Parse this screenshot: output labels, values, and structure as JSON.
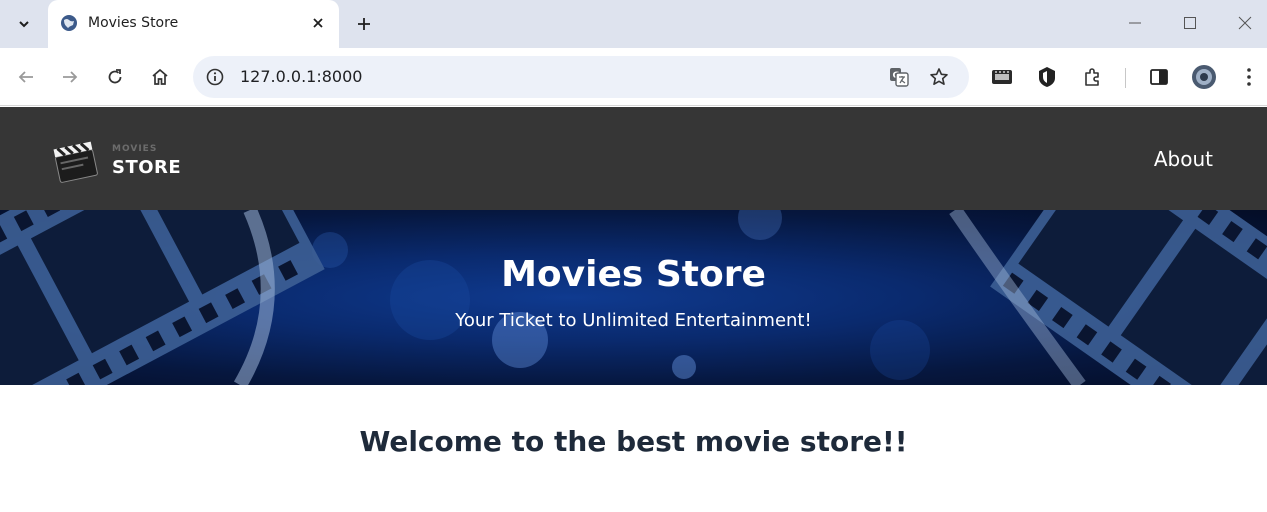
{
  "browser": {
    "tab_title": "Movies Store",
    "url": "127.0.0.1:8000"
  },
  "site": {
    "brand_top": "MOVIES",
    "brand": "STORE",
    "nav_about": "About"
  },
  "hero": {
    "title": "Movies Store",
    "subtitle": "Your Ticket to Unlimited Entertainment!"
  },
  "main": {
    "welcome": "Welcome to the best movie store!!"
  },
  "colors": {
    "tabstrip": "#dee3ee",
    "navbar": "#363636",
    "hero_blue": "#0a2a6e",
    "welcome_text": "#1e2a3a"
  }
}
